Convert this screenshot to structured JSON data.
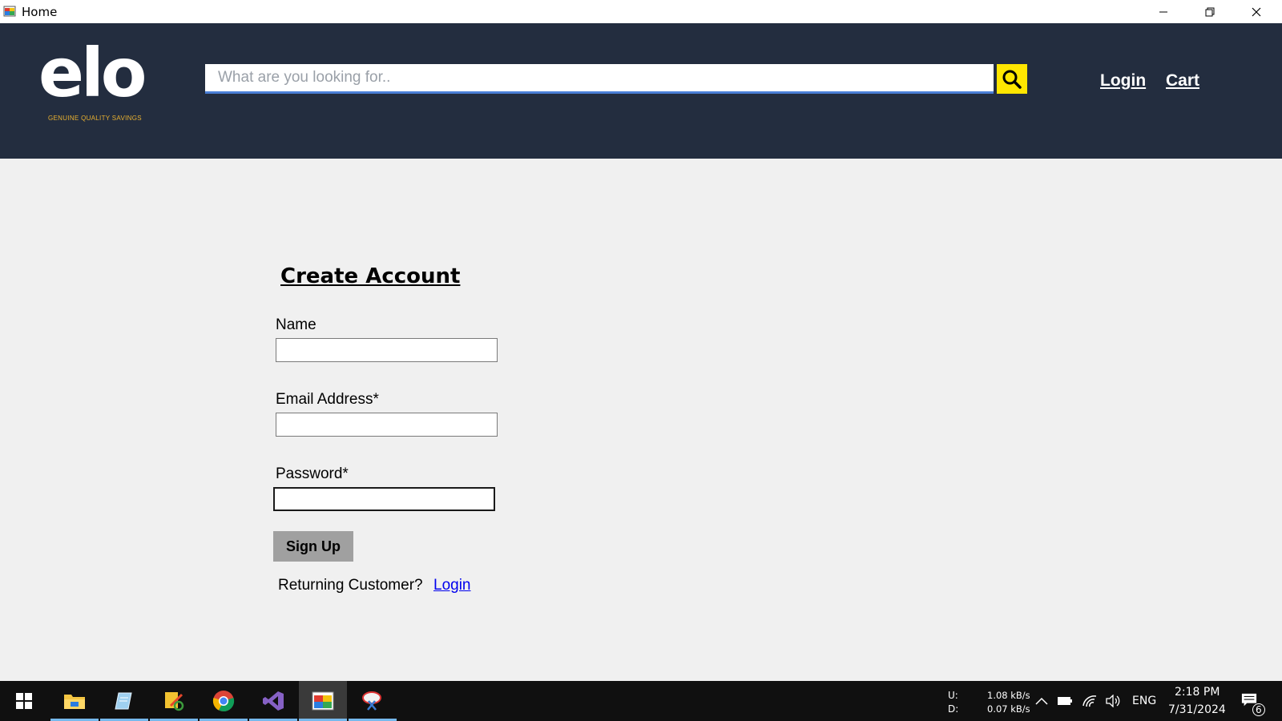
{
  "window": {
    "title": "Home",
    "app_icon": "app-icon",
    "controls": [
      "minimize-icon",
      "restore-icon",
      "close-icon"
    ]
  },
  "header": {
    "logo_text": "elo",
    "logo_tagline": "GENUINE QUALITY SAVINGS",
    "search_placeholder": "What are you looking for..",
    "search_value": "",
    "search_icon": "search-icon",
    "nav": {
      "login": "Login",
      "cart": "Cart"
    },
    "colors": {
      "background": "#232d3f",
      "search_button": "#ffe600",
      "tagline": "#e8b030"
    }
  },
  "form": {
    "title": "Create Account",
    "name_label": "Name",
    "name_value": "",
    "email_label": "Email Address*",
    "email_value": "",
    "password_label": "Password*",
    "password_value": "",
    "submit_label": "Sign Up",
    "returning_text": "Returning Customer?",
    "login_link": "Login"
  },
  "taskbar": {
    "apps": [
      "file-explorer-icon",
      "notepad-icon",
      "tools-icon",
      "chrome-icon",
      "visual-studio-icon",
      "winforms-app-icon",
      "snipping-tool-icon"
    ],
    "active_app": "winforms-app-icon",
    "net_upload_label": "U:",
    "net_upload": "1.08 kB/s",
    "net_download_label": "D:",
    "net_download": "0.07 kB/s",
    "language": "ENG",
    "time": "2:18 PM",
    "date": "7/31/2024",
    "notification_count": "6"
  }
}
